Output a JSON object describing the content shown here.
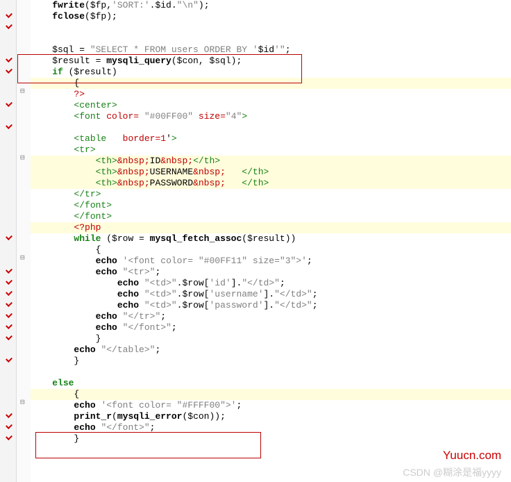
{
  "watermark1": "Yuucn.com",
  "watermark2": "CSDN @糊涂是福yyyy",
  "lines": [
    {
      "cls": "",
      "html": "<span class='fn'>fwrite</span>($fp,<span class='str'>'SORT:'</span>.$id.<span class='str'>\"\\n\"</span>);",
      "indent": 1,
      "tick": true
    },
    {
      "cls": "",
      "html": "<span class='fn'>fclose</span>($fp);",
      "indent": 1,
      "tick": true
    },
    {
      "cls": "",
      "html": "",
      "indent": 0
    },
    {
      "cls": "",
      "html": "",
      "indent": 0
    },
    {
      "cls": "",
      "html": "$sql = <span class='str'>\"SELECT * FROM users ORDER BY '</span><span class='var'>$id</span><span class='str'>'\"</span>;",
      "indent": 1,
      "tick": true
    },
    {
      "cls": "",
      "html": "$result = <span class='fn'>mysqli_query</span>($con, $sql);",
      "indent": 1,
      "tick": true
    },
    {
      "cls": "",
      "html": "<span class='kwgr'>if</span> ($result)",
      "indent": 1
    },
    {
      "cls": "hl",
      "html": "{",
      "indent": 2,
      "fold": true
    },
    {
      "cls": "",
      "html": "<span class='red'>?&gt;</span>",
      "indent": 2,
      "tick": true
    },
    {
      "cls": "",
      "html": "<span class='tagg'>&lt;center&gt;</span>",
      "indent": 2
    },
    {
      "cls": "",
      "html": "<span class='tagg'>&lt;font</span> <span class='red'>color=</span> <span class='str'>\"#00FF00\"</span> <span class='red'>size=</span><span class='str'>\"4\"</span><span class='tagg'>&gt;</span>",
      "indent": 2,
      "tick": true
    },
    {
      "cls": "",
      "html": "",
      "indent": 0
    },
    {
      "cls": "",
      "html": "<span class='tagg'>&lt;table</span>   <span class='red'>border=1</span>'<span class='tagg'>&gt;</span>",
      "indent": 2
    },
    {
      "cls": "",
      "html": "<span class='tagg'>&lt;tr&gt;</span>",
      "indent": 2,
      "fold": true
    },
    {
      "cls": "hl",
      "html": "<span class='tagg'>&lt;th&gt;</span><span class='red'>&amp;nbsp;</span>ID<span class='red'>&amp;nbsp;</span><span class='tagg'>&lt;/th&gt;</span>",
      "indent": 3
    },
    {
      "cls": "hl",
      "html": "<span class='tagg'>&lt;th&gt;</span><span class='red'>&amp;nbsp;</span>USERNAME<span class='red'>&amp;nbsp;</span>   <span class='tagg'>&lt;/th&gt;</span>",
      "indent": 3
    },
    {
      "cls": "hl",
      "html": "<span class='tagg'>&lt;th&gt;</span><span class='red'>&amp;nbsp;</span>PASSWORD<span class='red'>&amp;nbsp;</span>   <span class='tagg'>&lt;/th&gt;</span>",
      "indent": 3
    },
    {
      "cls": "",
      "html": "<span class='tagg'>&lt;/tr&gt;</span>",
      "indent": 2
    },
    {
      "cls": "",
      "html": "<span class='tagg'>&lt;/font&gt;</span>",
      "indent": 2
    },
    {
      "cls": "",
      "html": "<span class='tagg'>&lt;/font&gt;</span>",
      "indent": 2
    },
    {
      "cls": "hl",
      "html": "<span class='red'>&lt;?php</span>",
      "indent": 2,
      "tick": true
    },
    {
      "cls": "",
      "html": "<span class='kwgr'>while</span> ($row = <span class='fn'>mysql_fetch_assoc</span>($result))",
      "indent": 2
    },
    {
      "cls": "",
      "html": "{",
      "indent": 3,
      "fold": true
    },
    {
      "cls": "",
      "html": "<span class='fn'>echo</span> <span class='str'>'&lt;font color= \"#00FF11\" size=\"3\"&gt;'</span>;",
      "indent": 3,
      "tick": true
    },
    {
      "cls": "",
      "html": "<span class='fn'>echo</span> <span class='str'>\"&lt;tr&gt;\"</span>;",
      "indent": 3,
      "tick": true
    },
    {
      "cls": "",
      "html": "<span class='fn'>echo</span> <span class='str'>\"&lt;td&gt;\"</span>.$row[<span class='str'>'id'</span>].<span class='str'>\"&lt;/td&gt;\"</span>;",
      "indent": 4,
      "tick": true
    },
    {
      "cls": "",
      "html": "<span class='fn'>echo</span> <span class='str'>\"&lt;td&gt;\"</span>.$row[<span class='str'>'username'</span>].<span class='str'>\"&lt;/td&gt;\"</span>;",
      "indent": 4,
      "tick": true
    },
    {
      "cls": "",
      "html": "<span class='fn'>echo</span> <span class='str'>\"&lt;td&gt;\"</span>.$row[<span class='str'>'password'</span>].<span class='str'>\"&lt;/td&gt;\"</span>;",
      "indent": 4,
      "tick": true
    },
    {
      "cls": "",
      "html": "<span class='fn'>echo</span> <span class='str'>\"&lt;/tr&gt;\"</span>;",
      "indent": 3,
      "tick": true
    },
    {
      "cls": "",
      "html": "<span class='fn'>echo</span> <span class='str'>\"&lt;/font&gt;\"</span>;",
      "indent": 3,
      "tick": true
    },
    {
      "cls": "",
      "html": "}",
      "indent": 3
    },
    {
      "cls": "",
      "html": "<span class='fn'>echo</span> <span class='str'>\"&lt;/table&gt;\"</span>;",
      "indent": 2,
      "tick": true
    },
    {
      "cls": "",
      "html": "}",
      "indent": 2
    },
    {
      "cls": "",
      "html": "",
      "indent": 0
    },
    {
      "cls": "",
      "html": "<span class='kwgr'>else</span>",
      "indent": 1
    },
    {
      "cls": "hl",
      "html": "{",
      "indent": 2,
      "fold": true
    },
    {
      "cls": "",
      "html": "<span class='fn'>echo</span> <span class='str'>'&lt;font color= \"#FFFF00\"&gt;'</span>;",
      "indent": 2,
      "tick": true
    },
    {
      "cls": "",
      "html": "<span class='fn'>print_r</span>(<span class='fn'>mysqli_error</span>($con));",
      "indent": 2,
      "tick": true
    },
    {
      "cls": "",
      "html": "<span class='fn'>echo</span> <span class='str'>\"&lt;/font&gt;\"</span>;",
      "indent": 2,
      "tick": true
    },
    {
      "cls": "",
      "html": "}",
      "indent": 2
    },
    {
      "cls": "",
      "html": "",
      "indent": 0
    }
  ]
}
